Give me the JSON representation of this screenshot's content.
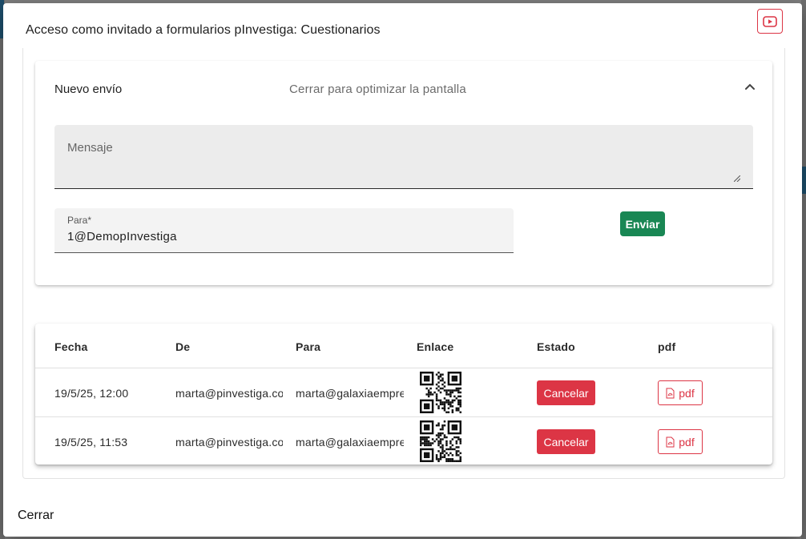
{
  "dialog": {
    "title": "Acceso como invitado a formularios pInvestiga: Cuestionarios",
    "close_label": "Cerrar",
    "video_icon": "youtube-icon"
  },
  "form": {
    "title": "Nuevo envío",
    "hint": "Cerrar para optimizar la pantalla",
    "collapse_icon": "chevron-up-icon",
    "message_placeholder": "Mensaje",
    "to_label": "Para*",
    "to_value": "1@DemopInvestiga",
    "send_label": "Enviar"
  },
  "table": {
    "headers": [
      "Fecha",
      "De",
      "Para",
      "Enlace",
      "Estado",
      "pdf"
    ],
    "rows": [
      {
        "date": "19/5/25, 12:00",
        "from": "marta@pinvestiga.com",
        "to": "marta@galaxiaempresas.com",
        "status_action": "Cancelar",
        "pdf_label": "pdf"
      },
      {
        "date": "19/5/25, 11:53",
        "from": "marta@pinvestiga.com",
        "to": "marta@galaxiaempresas.com",
        "status_action": "Cancelar",
        "pdf_label": "pdf"
      }
    ]
  },
  "colors": {
    "success": "#198754",
    "danger": "#dc3545"
  }
}
